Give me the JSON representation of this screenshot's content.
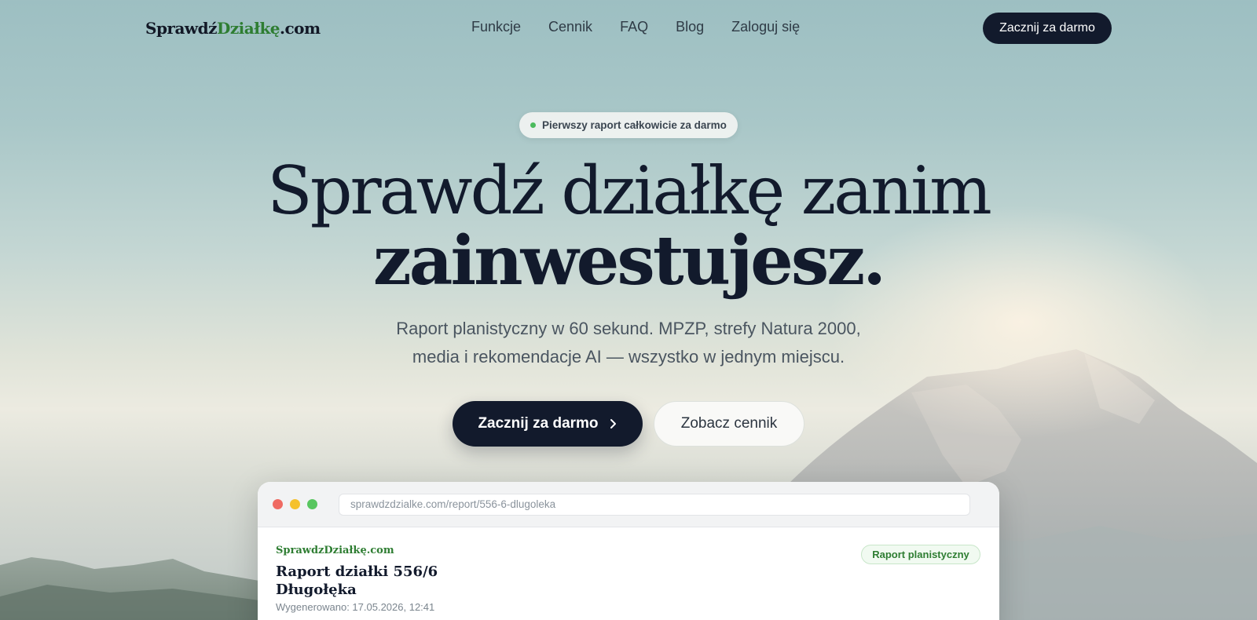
{
  "nav": {
    "logo_part1": "Sprawdź",
    "logo_part2": "Działkę",
    "logo_part3": ".com",
    "links": [
      "Funkcje",
      "Cennik",
      "FAQ",
      "Blog",
      "Zaloguj się"
    ],
    "cta": "Zacznij za darmo"
  },
  "hero": {
    "pill_text": "Pierwszy raport całkowicie za darmo",
    "title_line1": "Sprawdź działkę zanim",
    "title_line2": "zainwestujesz.",
    "subtitle_line1": "Raport planistyczny w 60 sekund. MPZP, strefy Natura 2000,",
    "subtitle_line2": "media i rekomendacje AI — wszystko w jednym miejscu.",
    "primary_button": "Zacznij za darmo",
    "secondary_button": "Zobacz cennik"
  },
  "preview": {
    "url": "sprawdzdzialke.com/report/556-6-dlugoleka",
    "brand": "SprawdzDziałkę.com",
    "report_title_line1": "Raport działki 556/6",
    "report_title_line2": "Długołęka",
    "generated": "Wygenerowano: 17.05.2026, 12:41",
    "badge": "Raport planistyczny"
  },
  "colors": {
    "navy": "#121a2c",
    "accent_green": "#2e7d32",
    "status_green": "#4cbb5e"
  }
}
